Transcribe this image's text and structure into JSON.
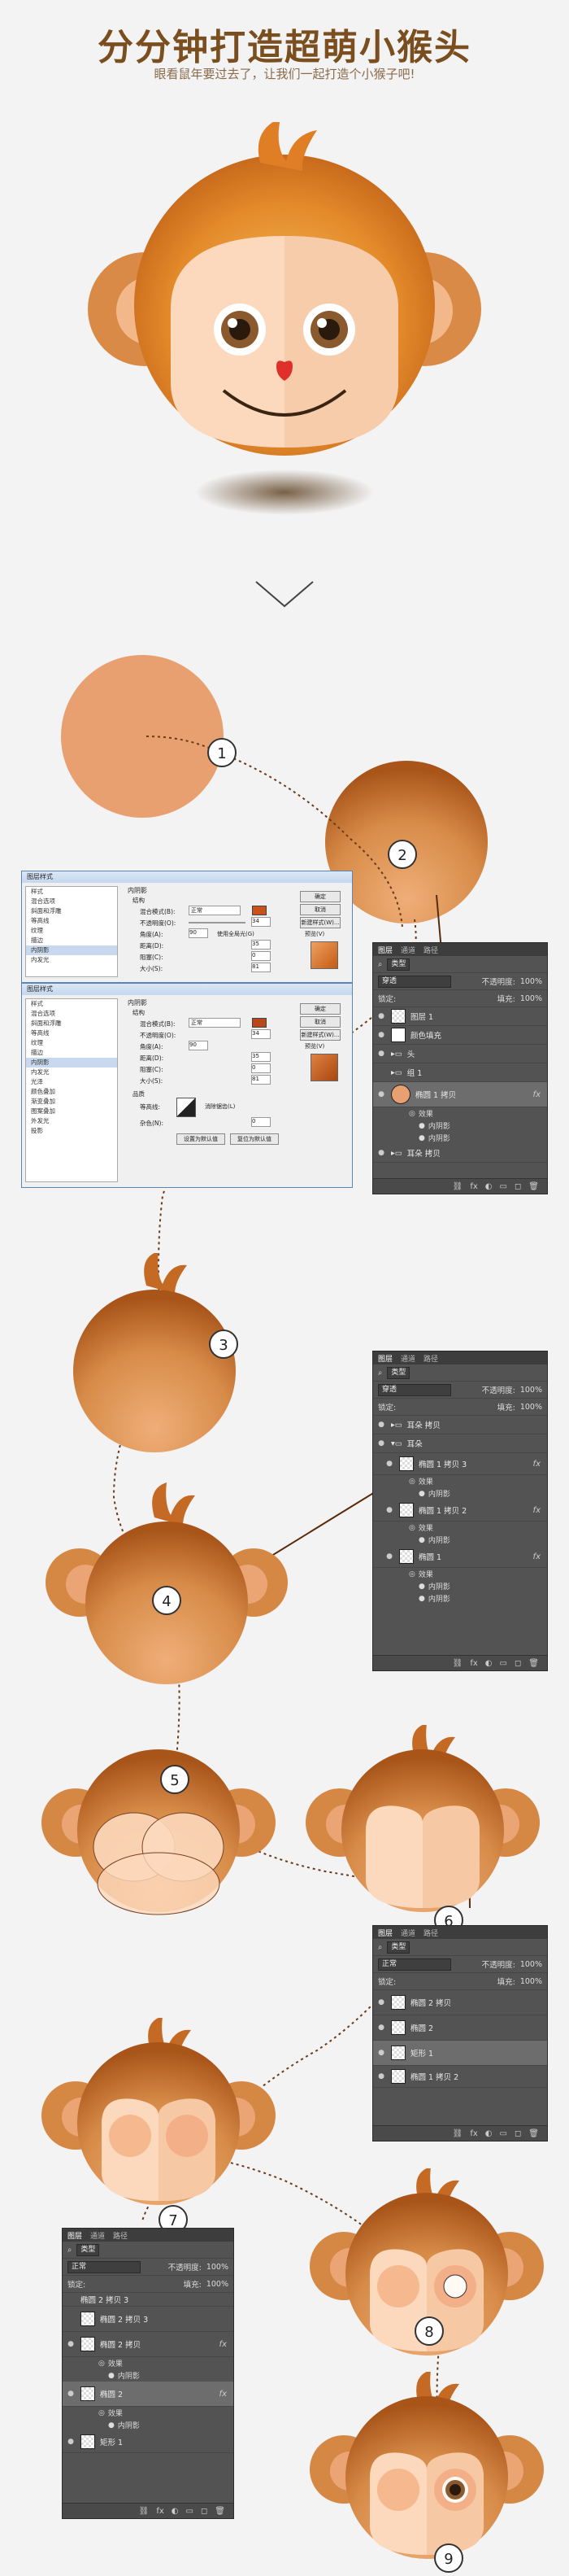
{
  "header": {
    "title": "分分钟打造超萌小猴头",
    "subtitle": "眼看鼠年要过去了，让我们一起打造个小猴子吧!"
  },
  "steps": {
    "s1": "1",
    "s2": "2",
    "s3": "3",
    "s4": "4",
    "s5": "5",
    "s6": "6",
    "s7": "7",
    "s8": "8",
    "s9": "9"
  },
  "colors": {
    "background": "#f3f3f3",
    "fur": "#c8742c",
    "face": "#fcd8bc",
    "title": "#7a4e1e"
  },
  "dialog": {
    "title": "图层样式",
    "left_items": [
      "样式",
      "混合选项",
      "斜面和浮雕",
      "等高线",
      "纹理",
      "描边",
      "内阴影",
      "内发光",
      "光泽",
      "颜色叠加",
      "渐变叠加",
      "图案叠加",
      "外发光",
      "投影"
    ],
    "section": "内阴影",
    "structure": "结构",
    "blend_mode_label": "混合模式(B):",
    "blend_mode": "正常",
    "opacity_label": "不透明度(O):",
    "opacity": "34",
    "angle_label": "角度(A):",
    "angle": "90",
    "global_light": "使用全局光(G)",
    "distance_label": "距离(D):",
    "distance": "35",
    "choke_label": "阻塞(C):",
    "choke": "0",
    "size_label": "大小(S):",
    "size": "81",
    "quality": "品质",
    "contour_label": "等高线:",
    "antialias": "消除锯齿(L)",
    "noise_label": "杂色(N):",
    "noise": "0",
    "ok": "确定",
    "cancel": "取消",
    "new_style": "新建样式(W)...",
    "preview": "预览(V)",
    "set_default": "设置为默认值",
    "reset_default": "复位为默认值"
  },
  "layers1": {
    "tabs": [
      "图层",
      "通道",
      "路径"
    ],
    "kind": "类型",
    "blend": "穿透",
    "opacity_label": "不透明度:",
    "opacity": "100%",
    "lock_label": "锁定:",
    "fill_label": "填充:",
    "fill": "100%",
    "rows": [
      "图层 1",
      "颜色填充",
      "头",
      "组 1",
      "椭圆 1 拷贝",
      "效果",
      "内阴影",
      "内阴影",
      "耳朵 拷贝"
    ]
  },
  "layers2": {
    "tabs": [
      "图层",
      "通道",
      "路径"
    ],
    "kind": "类型",
    "blend": "穿透",
    "opacity_label": "不透明度:",
    "opacity": "100%",
    "lock_label": "锁定:",
    "fill_label": "填充:",
    "fill": "100%",
    "rows": [
      "耳朵 拷贝",
      "耳朵",
      "椭圆 1 拷贝 3",
      "效果",
      "内阴影",
      "椭圆 1 拷贝 2",
      "效果",
      "内阴影",
      "椭圆 1",
      "效果",
      "内阴影",
      "内阴影"
    ]
  },
  "layers3": {
    "tabs": [
      "图层",
      "通道",
      "路径"
    ],
    "kind": "类型",
    "blend": "正常",
    "opacity_label": "不透明度:",
    "opacity": "100%",
    "lock_label": "锁定:",
    "fill_label": "填充:",
    "fill": "100%",
    "rows": [
      "椭圆 2 拷贝",
      "椭圆 2",
      "矩形 1",
      "椭圆 1 拷贝 2"
    ]
  },
  "layers4": {
    "tabs": [
      "图层",
      "通道",
      "路径"
    ],
    "kind": "类型",
    "blend": "正常",
    "opacity_label": "不透明度:",
    "opacity": "100%",
    "lock_label": "锁定:",
    "fill_label": "填充:",
    "fill": "100%",
    "rows": [
      "椭圆 2 拷贝 3",
      "椭圆 2 拷贝 3",
      "椭圆 2 拷贝",
      "效果",
      "内阴影",
      "椭圆 2",
      "效果",
      "内阴影",
      "矩形 1"
    ]
  }
}
